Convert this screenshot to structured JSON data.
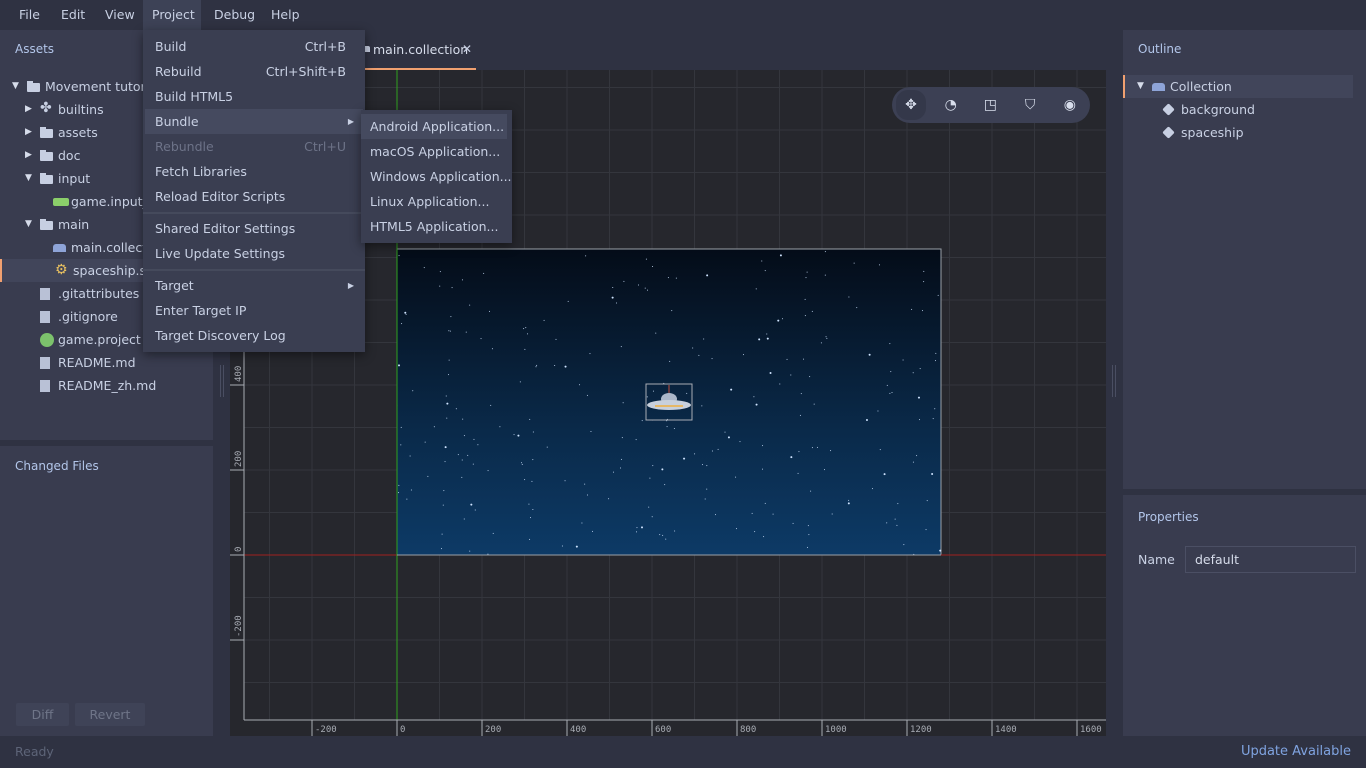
{
  "menubar": {
    "items": [
      "File",
      "Edit",
      "View",
      "Project",
      "Debug",
      "Help"
    ],
    "active": "Project"
  },
  "assets": {
    "title": "Assets",
    "tree": [
      {
        "label": "Movement tutoria",
        "icon": "folder-icon",
        "expanded": true,
        "depth": 0
      },
      {
        "label": "builtins",
        "icon": "puzzle-icon",
        "expanded": false,
        "depth": 1
      },
      {
        "label": "assets",
        "icon": "folder-icon",
        "expanded": false,
        "depth": 1
      },
      {
        "label": "doc",
        "icon": "folder-icon",
        "expanded": false,
        "depth": 1
      },
      {
        "label": "input",
        "icon": "folder-icon",
        "expanded": true,
        "depth": 1
      },
      {
        "label": "game.input_b",
        "icon": "input-binding-icon",
        "depth": 2
      },
      {
        "label": "main",
        "icon": "folder-icon",
        "expanded": true,
        "depth": 1
      },
      {
        "label": "main.collecti",
        "icon": "collection-icon",
        "depth": 2
      },
      {
        "label": "spaceship.sc",
        "icon": "script-gear-icon",
        "depth": 2,
        "selected": true
      },
      {
        "label": ".gitattributes",
        "icon": "file-icon",
        "depth": 1
      },
      {
        "label": ".gitignore",
        "icon": "file-icon",
        "depth": 1
      },
      {
        "label": "game.project",
        "icon": "project-icon",
        "depth": 1
      },
      {
        "label": "README.md",
        "icon": "file-icon",
        "depth": 1
      },
      {
        "label": "README_zh.md",
        "icon": "file-icon",
        "depth": 1
      }
    ]
  },
  "changed_files": {
    "title": "Changed Files",
    "diff": "Diff",
    "revert": "Revert"
  },
  "status": {
    "left": "Ready",
    "right": "Update Available"
  },
  "editor_tab": {
    "label": "main.collection",
    "close": "✕"
  },
  "project_menu": [
    {
      "label": "Build",
      "shortcut": "Ctrl+B"
    },
    {
      "label": "Rebuild",
      "shortcut": "Ctrl+Shift+B"
    },
    {
      "label": "Build HTML5"
    },
    {
      "label": "Bundle",
      "submenu": true,
      "highlighted": true
    },
    {
      "label": "Rebundle",
      "shortcut": "Ctrl+U",
      "disabled": true
    },
    {
      "label": "Fetch Libraries"
    },
    {
      "label": "Reload Editor Scripts"
    },
    {
      "separator": true
    },
    {
      "label": "Shared Editor Settings"
    },
    {
      "label": "Live Update Settings"
    },
    {
      "separator": true
    },
    {
      "label": "Target",
      "submenu": true
    },
    {
      "label": "Enter Target IP"
    },
    {
      "label": "Target Discovery Log"
    }
  ],
  "bundle_submenu": [
    "Android Application...",
    "macOS Application...",
    "Windows Application...",
    "Linux Application...",
    "HTML5 Application..."
  ],
  "bundle_highlighted": 0,
  "toolbar": [
    "move-tool-icon",
    "rotate-tool-icon",
    "scale-tool-icon",
    "perspective-icon",
    "visibility-icon"
  ],
  "toolbar_active": 0,
  "viewport": {
    "x_ticks": [
      -200,
      0,
      200,
      400,
      600,
      800,
      1000,
      1200,
      1400,
      1600
    ],
    "y_ticks": [
      -200,
      0,
      200,
      400
    ],
    "background_size": [
      1280,
      720
    ],
    "spaceship_position": [
      640,
      360
    ],
    "colors": {
      "x_axis": "#a02020",
      "y_axis": "#30a020",
      "grid": "#34363d",
      "bg": "#26272d"
    }
  },
  "outline": {
    "title": "Outline",
    "items": [
      {
        "label": "Collection",
        "icon": "collection-icon",
        "expanded": true,
        "depth": 0,
        "selected": true
      },
      {
        "label": "background",
        "icon": "game-object-icon",
        "depth": 1
      },
      {
        "label": "spaceship",
        "icon": "game-object-icon",
        "depth": 1
      }
    ]
  },
  "properties": {
    "title": "Properties",
    "name_label": "Name",
    "name_value": "default"
  },
  "accent": "#f0a070"
}
